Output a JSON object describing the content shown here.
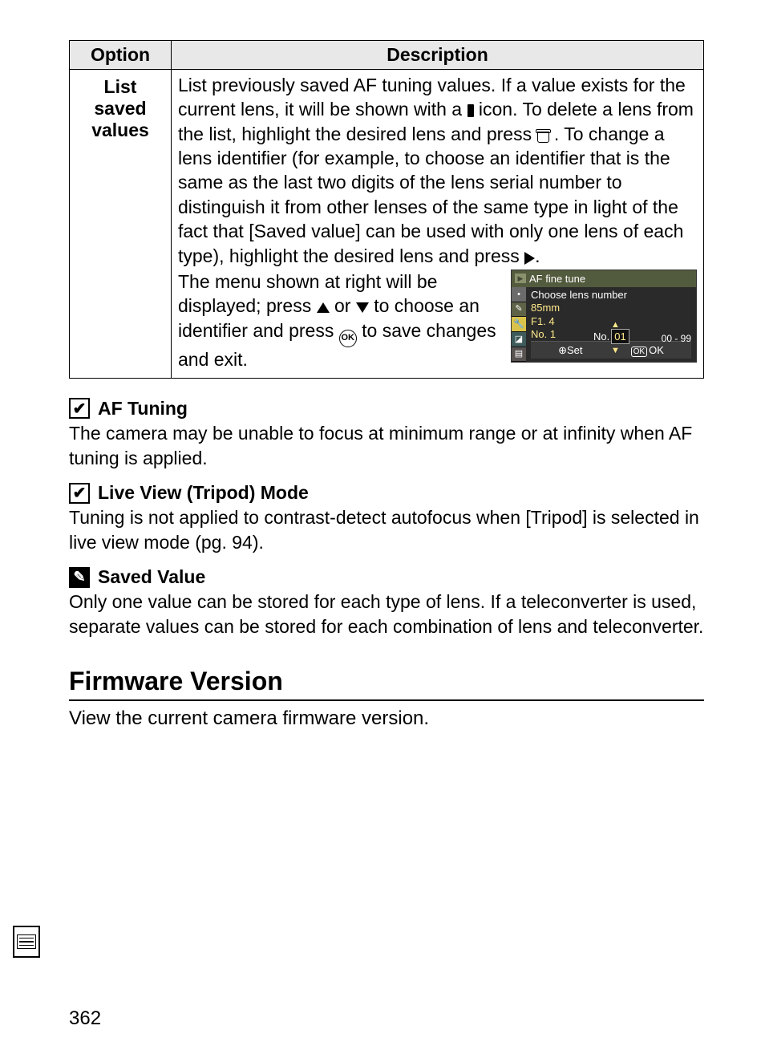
{
  "table": {
    "headers": {
      "option": "Option",
      "description": "Description"
    },
    "row": {
      "option_line1": "List",
      "option_line2": "saved",
      "option_line3": "values",
      "desc_top_a": "List previously saved AF tuning values.  If a value exists for the current lens, it will be shown with a ",
      "desc_top_b": " icon.  To delete a lens from the list, highlight the desired lens and press ",
      "desc_top_c": ".  To change a lens identifier (for example, to choose an identifier that is the same as the last two digits of the lens serial number to distinguish it from other lenses of the same type in light of the fact that [Saved value] can be used with only one lens of each type), highlight the desired lens and press ",
      "desc_top_d": ".",
      "desc_bottom_a": "The menu shown at right will be displayed; press ",
      "desc_bottom_b": " or ",
      "desc_bottom_c": " to choose an identifier and press ",
      "desc_bottom_d": " to save changes and exit.",
      "ok_label": "OK"
    }
  },
  "menu_mock": {
    "title": "AF fine tune",
    "sub": "Choose lens number",
    "l1": "85mm",
    "l2": "F1. 4",
    "l3": "No. 1",
    "no_label": "No.",
    "no_value": "01",
    "range": "00 - 99",
    "footer_left": "Set",
    "footer_right_ok": "OK",
    "footer_right_txt": "OK"
  },
  "notes": {
    "n1_title": "AF Tuning",
    "n1_body": "The camera may be unable to focus at minimum range or at infinity when AF tuning is applied.",
    "n2_title": "Live View (Tripod) Mode",
    "n2_body": "Tuning is not applied to contrast-detect autofocus when [Tripod] is selected in live view mode (pg. 94).",
    "n3_title": "Saved Value",
    "n3_body": "Only one value can be stored for each type of lens.  If a teleconverter is used, separate values can be stored for each combination of lens and teleconverter."
  },
  "section": {
    "title": "Firmware Version",
    "body": "View the current camera firmware version."
  },
  "page_number": "362"
}
